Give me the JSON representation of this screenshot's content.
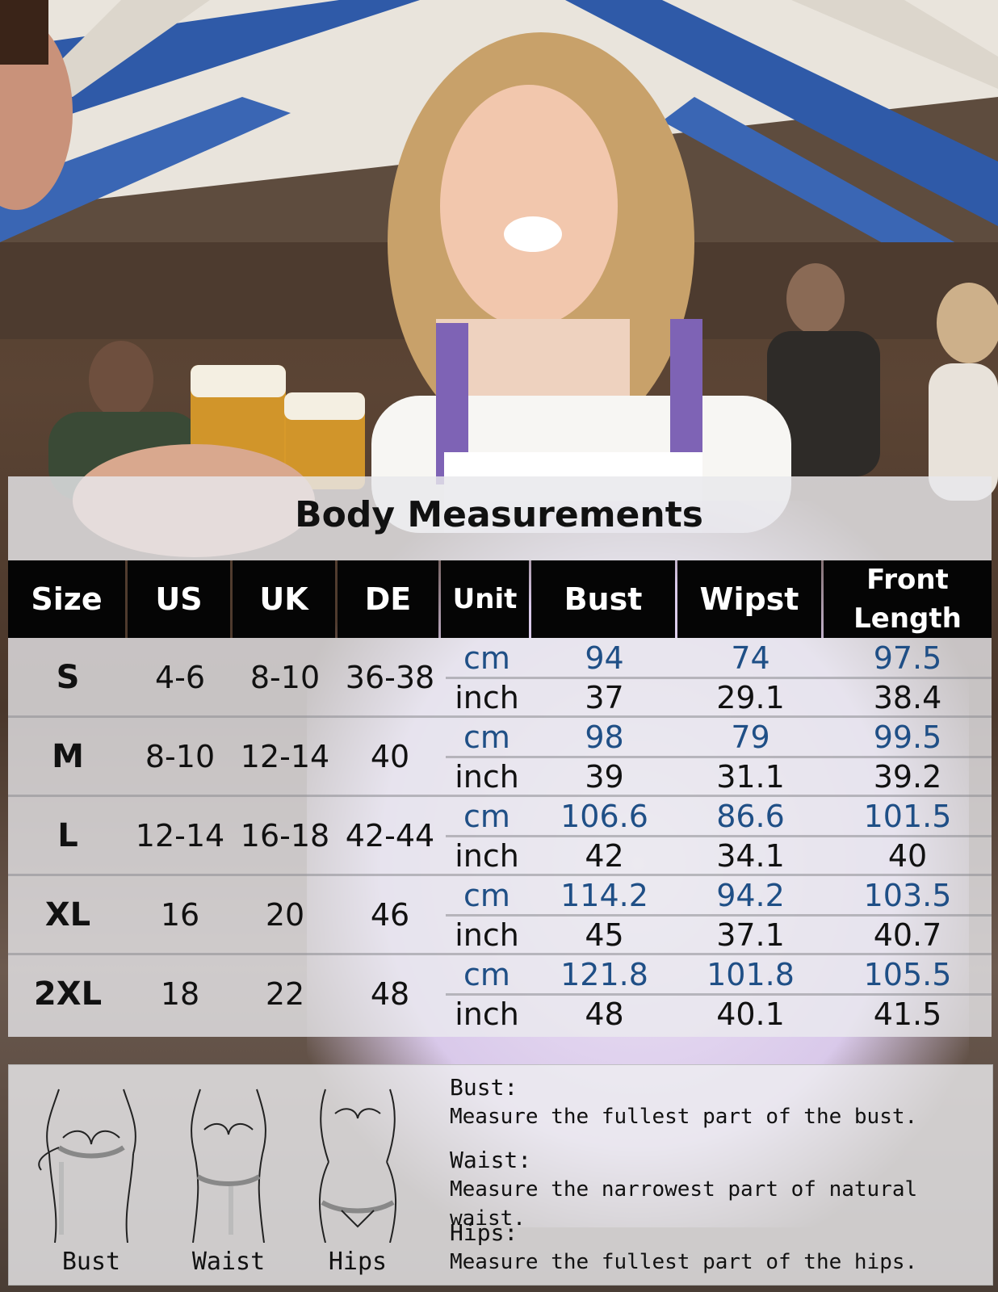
{
  "title": "Body Measurements",
  "colors": {
    "header_bg": "#050505",
    "cm_text": "#1f4f86",
    "accent_dress": "#8a6bc0"
  },
  "table": {
    "headers": {
      "size": "Size",
      "us": "US",
      "uk": "UK",
      "de": "DE",
      "unit": "Unit",
      "bust": "Bust",
      "wipst": "Wipst",
      "front_length": "Front Length"
    },
    "rows": [
      {
        "size": "S",
        "us": "4-6",
        "uk": "8-10",
        "de": "36-38",
        "cm": {
          "unit": "cm",
          "bust": "94",
          "waist": "74",
          "front": "97.5"
        },
        "inch": {
          "unit": "inch",
          "bust": "37",
          "waist": "29.1",
          "front": "38.4"
        }
      },
      {
        "size": "M",
        "us": "8-10",
        "uk": "12-14",
        "de": "40",
        "cm": {
          "unit": "cm",
          "bust": "98",
          "waist": "79",
          "front": "99.5"
        },
        "inch": {
          "unit": "inch",
          "bust": "39",
          "waist": "31.1",
          "front": "39.2"
        }
      },
      {
        "size": "L",
        "us": "12-14",
        "uk": "16-18",
        "de": "42-44",
        "cm": {
          "unit": "cm",
          "bust": "106.6",
          "waist": "86.6",
          "front": "101.5"
        },
        "inch": {
          "unit": "inch",
          "bust": "42",
          "waist": "34.1",
          "front": "40"
        }
      },
      {
        "size": "XL",
        "us": "16",
        "uk": "20",
        "de": "46",
        "cm": {
          "unit": "cm",
          "bust": "114.2",
          "waist": "94.2",
          "front": "103.5"
        },
        "inch": {
          "unit": "inch",
          "bust": "45",
          "waist": "37.1",
          "front": "40.7"
        }
      },
      {
        "size": "2XL",
        "us": "18",
        "uk": "22",
        "de": "48",
        "cm": {
          "unit": "cm",
          "bust": "121.8",
          "waist": "101.8",
          "front": "105.5"
        },
        "inch": {
          "unit": "inch",
          "bust": "48",
          "waist": "40.1",
          "front": "41.5"
        }
      }
    ]
  },
  "guide": {
    "figures": [
      {
        "label": "Bust",
        "icon": "bust-measure-icon"
      },
      {
        "label": "Waist",
        "icon": "waist-measure-icon"
      },
      {
        "label": "Hips",
        "icon": "hips-measure-icon"
      }
    ],
    "tips": [
      {
        "heading": "Bust:",
        "text": "Measure the fullest part of the bust."
      },
      {
        "heading": "Waist:",
        "text": "Measure the narrowest part of natural waist."
      },
      {
        "heading": "Hips:",
        "text": "Measure the fullest part of the hips."
      }
    ]
  }
}
